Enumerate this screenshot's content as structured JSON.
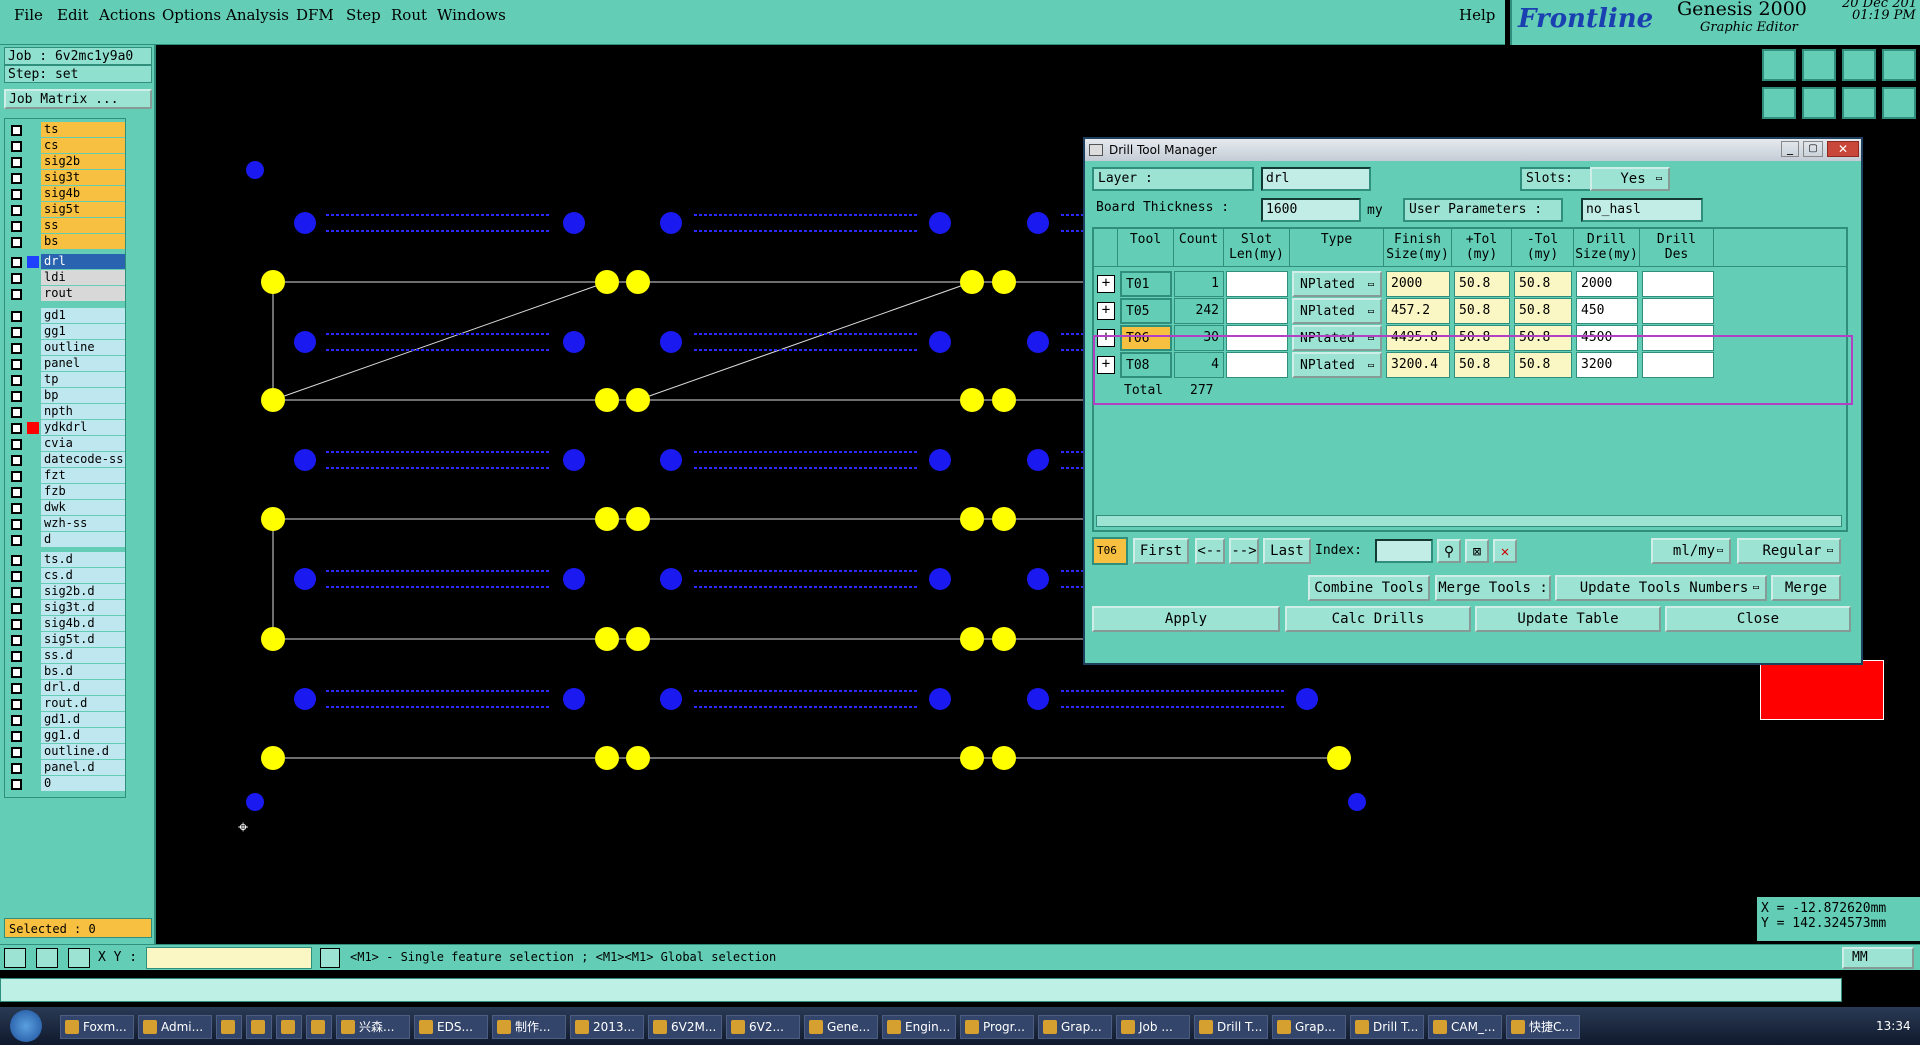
{
  "menu": [
    "File",
    "Edit",
    "Actions",
    "Options",
    "Analysis",
    "DFM",
    "Step",
    "Rout",
    "Windows"
  ],
  "help": "Help",
  "brand": {
    "logo": "Frontline",
    "product": "Genesis 2000",
    "subtitle": "Graphic Editor",
    "date": "20 Dec 201",
    "time": "01:19 PM"
  },
  "job": {
    "job_line": "Job : 6v2mc1y9a0",
    "step_line": "Step: set",
    "matrix_button": "Job Matrix ..."
  },
  "layers": [
    {
      "name": "ts",
      "style": "or"
    },
    {
      "name": "cs",
      "style": "or"
    },
    {
      "name": "sig2b",
      "style": "or"
    },
    {
      "name": "sig3t",
      "style": "or"
    },
    {
      "name": "sig4b",
      "style": "or"
    },
    {
      "name": "sig5t",
      "style": "or"
    },
    {
      "name": "ss",
      "style": "or"
    },
    {
      "name": "bs",
      "style": "or"
    },
    {
      "name": "drl",
      "style": "sel"
    },
    {
      "name": "ldi",
      "style": "gr"
    },
    {
      "name": "rout",
      "style": "gr"
    },
    {
      "name": "gd1",
      "style": ""
    },
    {
      "name": "gg1",
      "style": ""
    },
    {
      "name": "outline",
      "style": ""
    },
    {
      "name": "panel",
      "style": ""
    },
    {
      "name": "tp",
      "style": ""
    },
    {
      "name": "bp",
      "style": ""
    },
    {
      "name": "npth",
      "style": ""
    },
    {
      "name": "ydkdrl",
      "style": ""
    },
    {
      "name": "cvia",
      "style": ""
    },
    {
      "name": "datecode-ss",
      "style": ""
    },
    {
      "name": "fzt",
      "style": ""
    },
    {
      "name": "fzb",
      "style": ""
    },
    {
      "name": "dwk",
      "style": ""
    },
    {
      "name": "wzh-ss",
      "style": ""
    },
    {
      "name": "d",
      "style": ""
    },
    {
      "name": "ts.d",
      "style": ""
    },
    {
      "name": "cs.d",
      "style": ""
    },
    {
      "name": "sig2b.d",
      "style": ""
    },
    {
      "name": "sig3t.d",
      "style": ""
    },
    {
      "name": "sig4b.d",
      "style": ""
    },
    {
      "name": "sig5t.d",
      "style": ""
    },
    {
      "name": "ss.d",
      "style": ""
    },
    {
      "name": "bs.d",
      "style": ""
    },
    {
      "name": "drl.d",
      "style": ""
    },
    {
      "name": "rout.d",
      "style": ""
    },
    {
      "name": "gd1.d",
      "style": ""
    },
    {
      "name": "gg1.d",
      "style": ""
    },
    {
      "name": "outline.d",
      "style": ""
    },
    {
      "name": "panel.d",
      "style": ""
    },
    {
      "name": "0",
      "style": ""
    }
  ],
  "selected": "Selected : 0",
  "coords": {
    "x": "X = -12.872620mm",
    "y": "Y = 142.324573mm"
  },
  "cmd": {
    "xy_label": "X Y :",
    "hint": "<M1> - Single feature selection ; <M1><M1> Global selection",
    "unit": "MM"
  },
  "dialog": {
    "title": "Drill Tool Manager",
    "layer_label": "Layer :",
    "layer_value": "drl",
    "slots_label": "Slots:",
    "slots_value": "Yes",
    "thickness_label": "Board Thickness :",
    "thickness_value": "1600",
    "thickness_unit": "my",
    "user_params_label": "User Parameters :",
    "user_params_value": "no_hasl",
    "headers": [
      {
        "line1": "",
        "line2": ""
      },
      {
        "line1": "Tool",
        "line2": ""
      },
      {
        "line1": "Count",
        "line2": ""
      },
      {
        "line1": "Slot",
        "line2": "Len(my)"
      },
      {
        "line1": "Type",
        "line2": ""
      },
      {
        "line1": "Finish",
        "line2": "Size(my)"
      },
      {
        "line1": "+Tol",
        "line2": "(my)"
      },
      {
        "line1": "-Tol",
        "line2": "(my)"
      },
      {
        "line1": "Drill",
        "line2": "Size(my)"
      },
      {
        "line1": "Drill",
        "line2": "Des"
      }
    ],
    "rows": [
      {
        "tool": "T01",
        "count": "1",
        "slot": "",
        "type": "NPlated",
        "finish": "2000",
        "ptol": "50.8",
        "mtol": "50.8",
        "drill": "2000",
        "des": ""
      },
      {
        "tool": "T05",
        "count": "242",
        "slot": "",
        "type": "NPlated",
        "finish": "457.2",
        "ptol": "50.8",
        "mtol": "50.8",
        "drill": "450",
        "des": ""
      },
      {
        "tool": "T06",
        "count": "30",
        "slot": "",
        "type": "NPlated",
        "finish": "4495.8",
        "ptol": "50.8",
        "mtol": "50.8",
        "drill": "4500",
        "des": "",
        "active": true
      },
      {
        "tool": "T08",
        "count": "4",
        "slot": "",
        "type": "NPlated",
        "finish": "3200.4",
        "ptol": "50.8",
        "mtol": "50.8",
        "drill": "3200",
        "des": ""
      }
    ],
    "total_label": "Total",
    "total_value": "277",
    "nav": {
      "current": "T06",
      "first": "First",
      "prev": "<--",
      "next": "-->",
      "last": "Last",
      "index_label": "Index:",
      "units": "ml/my",
      "mode": "Regular"
    },
    "buttons": {
      "combine": "Combine Tools",
      "merge_label": "Merge Tools :",
      "update_numbers": "Update Tools Numbers",
      "merge": "Merge",
      "apply": "Apply",
      "calc": "Calc Drills",
      "update_table": "Update Table",
      "close": "Close"
    }
  },
  "taskbar": {
    "items": [
      "Foxm...",
      "Admi...",
      "",
      "",
      "",
      "",
      "兴森...",
      "EDS...",
      "制作...",
      "2013...",
      "6V2M...",
      "6V2...",
      "Gene...",
      "Engin...",
      "Progr...",
      "Grap...",
      "Job ...",
      "Drill T...",
      "Grap...",
      "Drill T...",
      "CAM_...",
      "快捷C..."
    ],
    "clock": "13:34"
  }
}
